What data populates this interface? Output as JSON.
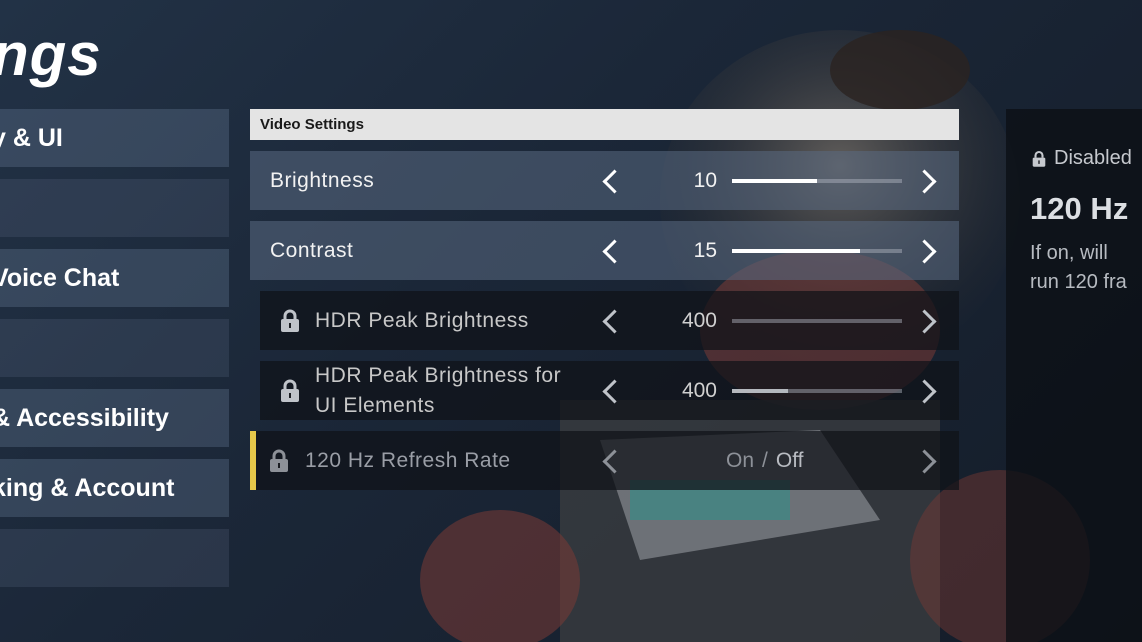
{
  "page": {
    "title": "ngs"
  },
  "sidebar": {
    "items": [
      {
        "label": "y & UI"
      },
      {
        "label": ""
      },
      {
        "label": "Voice Chat"
      },
      {
        "label": ""
      },
      {
        "label": " & Accessibility"
      },
      {
        "label": "king & Account"
      },
      {
        "label": ""
      }
    ]
  },
  "panel": {
    "header": "Video Settings",
    "rows": [
      {
        "label": "Brightness",
        "value": "10",
        "level": 0.5,
        "locked": false
      },
      {
        "label": "Contrast",
        "value": "15",
        "level": 0.75,
        "locked": false
      },
      {
        "label": "HDR Peak Brightness",
        "value": "400",
        "level": 0.0,
        "locked": true
      },
      {
        "label_line1": "HDR Peak Brightness for",
        "label_line2": "UI Elements",
        "value": "400",
        "level": 0.33,
        "locked": true
      },
      {
        "label": "120 Hz Refresh Rate",
        "on": "On",
        "sep": "/",
        "off": "Off",
        "selected": "Off",
        "locked": true
      }
    ]
  },
  "info": {
    "status": "Disabled",
    "title": "120 Hz",
    "desc_line1": "If on, will",
    "desc_line2": "run 120 fra"
  },
  "icons": {
    "lock": "lock-icon",
    "left": "chevron-left-icon",
    "right": "chevron-right-icon"
  },
  "colors": {
    "focus_accent": "#e6c84a",
    "header_bg": "#e4e4e4"
  }
}
